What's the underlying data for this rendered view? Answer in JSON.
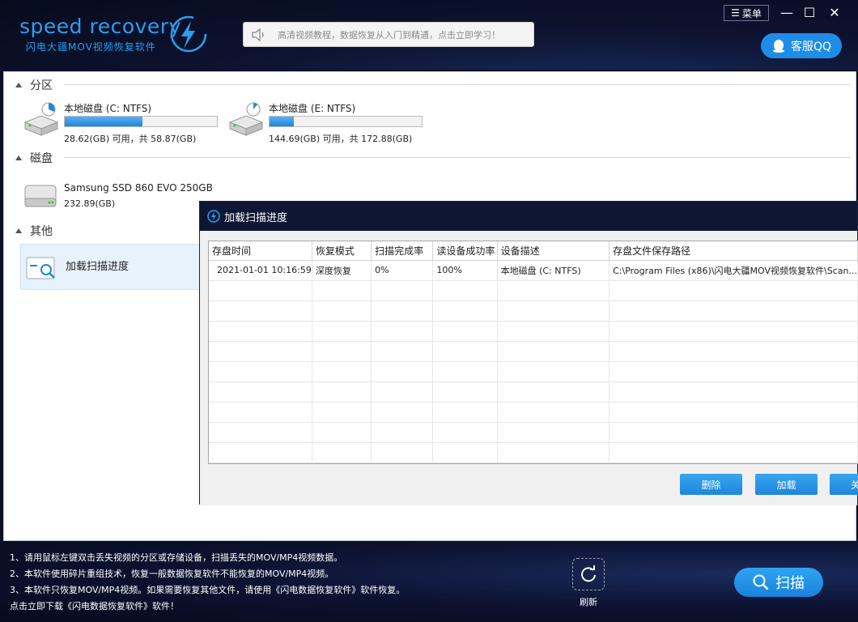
{
  "header": {
    "logo_title": "speed recovery",
    "logo_subtitle": "闪电大疆MOV视频恢复软件",
    "notice_text": "高清视频教程，数据恢复从入门到精通，点击立即学习！",
    "menu_label": "菜单",
    "qq_label": "客服QQ"
  },
  "sections": {
    "partition": "分区",
    "disk": "磁盘",
    "other": "其他"
  },
  "partitions": [
    {
      "name": "本地磁盘 (C: NTFS)",
      "size": "28.62(GB) 可用，共 58.87(GB)",
      "used_fraction": 0.51
    },
    {
      "name": "本地磁盘 (E: NTFS)",
      "size": "144.69(GB) 可用，共 172.88(GB)",
      "used_fraction": 0.16
    }
  ],
  "disks": [
    {
      "name": "Samsung SSD 860 EVO 250GB",
      "size": "232.89(GB)"
    }
  ],
  "other_items": [
    {
      "label": "加载扫描进度"
    }
  ],
  "dialog": {
    "title": "加载扫描进度",
    "columns": [
      "存盘时间",
      "恢复模式",
      "扫描完成率",
      "读设备成功率",
      "设备描述",
      "存盘文件保存路径"
    ],
    "rows": [
      [
        "2021-01-01 10:16:59",
        "深度恢复",
        "0%",
        "100%",
        "本地磁盘 (C: NTFS)",
        "C:\\Program Files (x86)\\闪电大疆MOV视频恢复软件\\Scan..."
      ]
    ],
    "buttons": {
      "delete": "删除",
      "load": "加载",
      "close": "关"
    }
  },
  "footer": {
    "tips": [
      "1、请用鼠标左键双击丢失视频的分区或存储设备，扫描丢失的MOV/MP4视频数据。",
      "2、本软件使用碎片重组技术，恢复一般数据恢复软件不能恢复的MOV/MP4视频。",
      "3、本软件只恢复MOV/MP4视频。如果需要恢复其他文件，请使用《闪电数据恢复软件》软件恢复。",
      "    点击立即下载《闪电数据恢复软件》软件！"
    ],
    "refresh_label": "刷新",
    "scan_label": "扫描"
  },
  "colors": {
    "accent": "#1f8de8",
    "header_bg": "#0b1026",
    "dialog_title_bg": "#0f1634"
  }
}
